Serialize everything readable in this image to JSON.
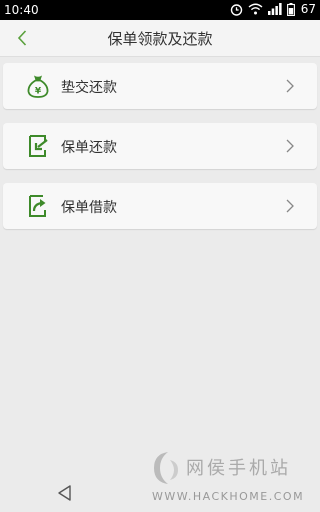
{
  "status_bar": {
    "time": "10:40",
    "battery": "67",
    "icons": [
      "alarm-icon",
      "wifi-icon",
      "signal-icon",
      "battery-icon"
    ]
  },
  "header": {
    "title": "保单领款及还款",
    "back_icon": "chevron-left-icon"
  },
  "menu": {
    "items": [
      {
        "label": "垫交还款",
        "icon": "money-bag-icon"
      },
      {
        "label": "保单还款",
        "icon": "document-return-icon"
      },
      {
        "label": "保单借款",
        "icon": "document-share-icon"
      }
    ]
  },
  "watermark": {
    "title": "网侯手机站",
    "url": "WWW.HACKHOME.COM"
  },
  "nav_bar": {
    "back_icon": "triangle-back-icon"
  },
  "colors": {
    "accent": "#3e8a2a",
    "back_arrow": "#5aa03c",
    "background": "#ebebeb",
    "card": "#f8f8f8",
    "title_bar": "#f4f4f4"
  }
}
